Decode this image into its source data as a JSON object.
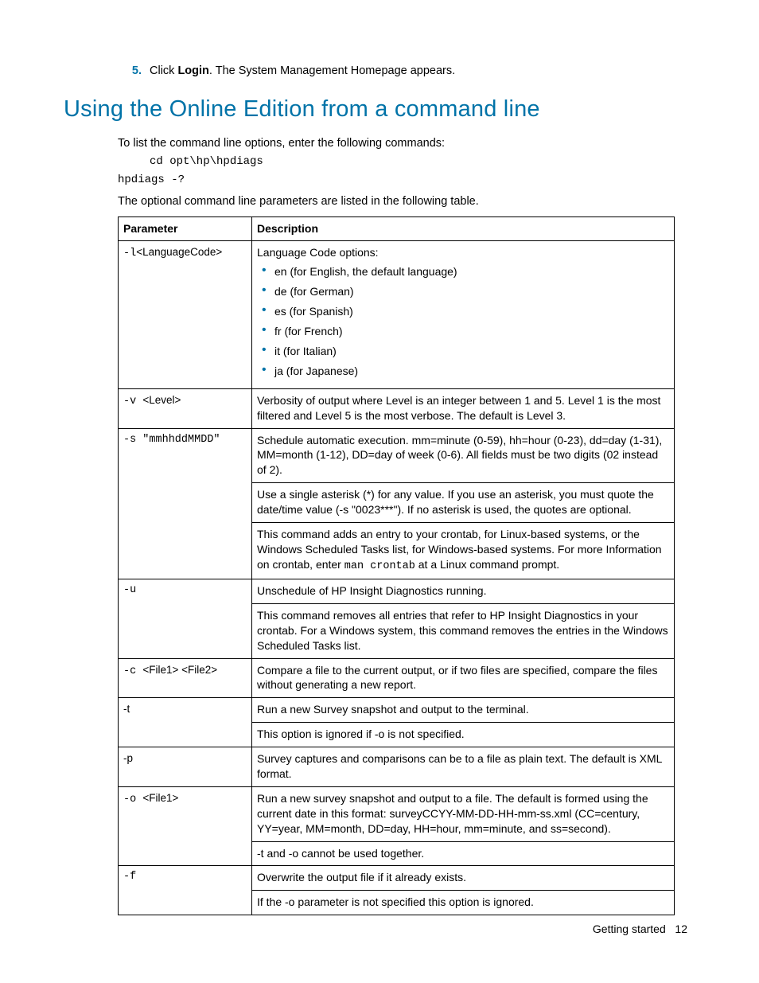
{
  "step": {
    "num": "5.",
    "prefix": "Click ",
    "bold": "Login",
    "suffix": ". The System Management Homepage appears."
  },
  "heading": "Using the Online Edition from a command line",
  "intro": "To list the command line options, enter the following commands:",
  "cmd1": "cd opt\\hp\\hpdiags",
  "cmd2": "hpdiags -?",
  "intro2": "The optional command line parameters are listed in the following table.",
  "headers": {
    "param": "Parameter",
    "desc": "Description"
  },
  "row_l": {
    "p_pre": "-l",
    "p_suf": "<LanguageCode>",
    "lead": "Language Code options:",
    "opts": [
      "en (for English, the default language)",
      "de (for German)",
      "es (for Spanish)",
      "fr (for French)",
      "it (for Italian)",
      "ja (for Japanese)"
    ]
  },
  "row_v": {
    "p_pre": "-v ",
    "p_suf": "<Level>",
    "d": "Verbosity of output where Level is an integer between 1 and 5. Level 1 is the most filtered and Level 5 is the most verbose. The default is Level 3."
  },
  "row_s": {
    "p": "-s \"mmhhddMMDD\"",
    "d1": "Schedule automatic execution. mm=minute (0-59), hh=hour (0-23), dd=day (1-31), MM=month (1-12), DD=day of week (0-6). All fields must be two digits (02 instead of 2).",
    "d2": "Use a single asterisk (*) for any value. If you use an asterisk, you must quote the date/time value (-s \"0023***\"). If no asterisk is used, the quotes are optional.",
    "d3a": "This command adds an entry to your crontab, for Linux-based systems, or the Windows Scheduled Tasks list, for Windows-based systems. For more Information on crontab, enter ",
    "d3code": "man crontab",
    "d3b": " at a Linux command prompt."
  },
  "row_u": {
    "p": "-u",
    "d1": "Unschedule of HP Insight Diagnostics running.",
    "d2": "This command removes all entries that refer to HP Insight Diagnostics in your crontab. For a Windows system, this command removes the entries in the Windows Scheduled Tasks list."
  },
  "row_c": {
    "p_pre": "-c ",
    "p_suf": "<File1> <File2>",
    "d": "Compare a file to the current output, or if two files are specified, compare the files without generating a new report."
  },
  "row_t": {
    "p": "-t",
    "d1": "Run a new Survey snapshot and output to the terminal.",
    "d2": "This option is ignored if -o is not specified."
  },
  "row_p": {
    "p": "-p",
    "d": "Survey captures and comparisons can be to a file as plain text. The default is XML format."
  },
  "row_o": {
    "p_pre": "-o ",
    "p_suf": "<File1>",
    "d1": "Run a new survey snapshot and output to a file. The default is formed using the current date in this format: surveyCCYY-MM-DD-HH-mm-ss.xml (CC=century, YY=year, MM=month, DD=day, HH=hour, mm=minute, and ss=second).",
    "d2": "-t and -o cannot be used together."
  },
  "row_f": {
    "p": "-f",
    "d1": "Overwrite the output file if it already exists.",
    "d2": "If the -o parameter is not specified this option is ignored."
  },
  "footer": {
    "section": "Getting started",
    "page": "12"
  }
}
